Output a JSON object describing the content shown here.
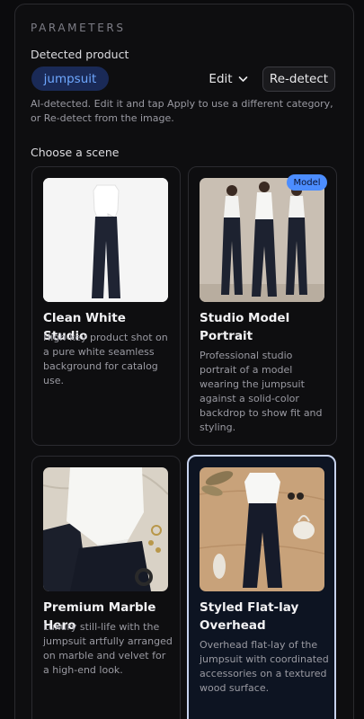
{
  "parameters": {
    "section_title": "PARAMETERS",
    "detected_label": "Detected product",
    "product_chip": "jumpsuit",
    "edit_label": "Edit",
    "redetect_label": "Re-detect",
    "helper_text": "AI-detected. Edit it and tap Apply to use a different category, or Re-detect from the image.",
    "scene_label": "Choose a scene"
  },
  "scenes": [
    {
      "title": "Clean White Studio",
      "desc": "High-key product shot on a pure white seamless background for catalog use.",
      "badge": "",
      "selected": false
    },
    {
      "title": "Studio Model Portrait",
      "desc": "Professional studio portrait of a model wearing the jumpsuit against a solid-color backdrop to show fit and styling.",
      "badge": "Model",
      "selected": false
    },
    {
      "title": "Premium Marble Hero",
      "desc": "Luxury still-life with the jumpsuit artfully arranged on marble and velvet for a high-end look.",
      "badge": "",
      "selected": false
    },
    {
      "title": "Styled Flat-lay Overhead",
      "desc": "Overhead flat-lay of the jumpsuit with coordinated accessories on a textured wood surface.",
      "badge": "",
      "selected": true
    }
  ],
  "colors": {
    "accent": "#4c8dff",
    "chip_bg": "#1a2a57",
    "chip_text": "#6ea8ff",
    "selected_border": "#c7d3ee"
  }
}
